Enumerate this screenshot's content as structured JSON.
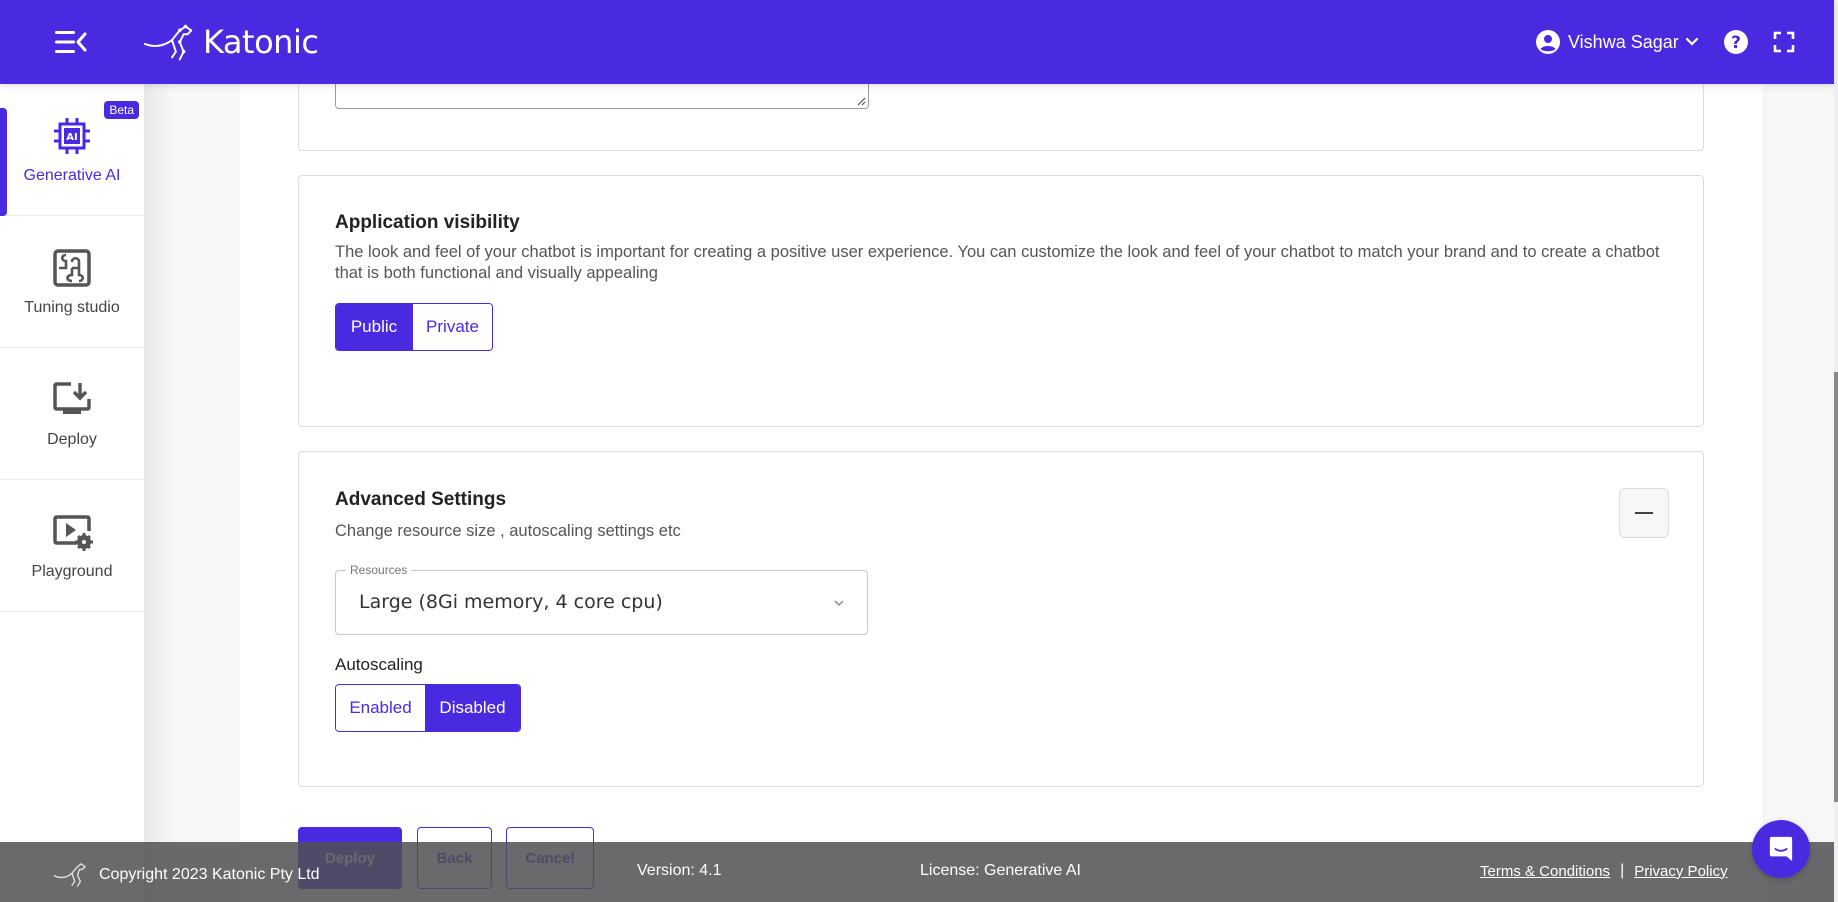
{
  "header": {
    "brand": "Katonic",
    "user_name": "Vishwa Sagar",
    "colors": {
      "primary": "#4a2ae0"
    }
  },
  "sidebar": {
    "items": [
      {
        "label": "Generative AI",
        "icon": "ai-chip-icon",
        "badge": "Beta",
        "active": true
      },
      {
        "label": "Tuning studio",
        "icon": "puzzle-icon",
        "active": false
      },
      {
        "label": "Deploy",
        "icon": "monitor-download-icon",
        "active": false
      },
      {
        "label": "Playground",
        "icon": "video-settings-icon",
        "active": false
      }
    ]
  },
  "visibility": {
    "title": "Application visibility",
    "description": "The look and feel of your chatbot is important for creating a positive user experience. You can customize the look and feel of your chatbot to match your brand and to create a chatbot that is both functional and visually appealing",
    "options": [
      "Public",
      "Private"
    ],
    "selected": "Public"
  },
  "advanced": {
    "title": "Advanced Settings",
    "description": "Change resource size , autoscaling settings etc",
    "resources_label": "Resources",
    "resources_value": "Large (8Gi memory, 4 core cpu)",
    "autoscaling_label": "Autoscaling",
    "autoscaling_options": [
      "Enabled",
      "Disabled"
    ],
    "autoscaling_selected": "Disabled"
  },
  "actions": {
    "deploy": "Deploy",
    "back": "Back",
    "cancel": "Cancel"
  },
  "footer": {
    "copyright": "Copyright 2023 Katonic Pty Ltd",
    "version": "Version: 4.1",
    "license": "License: Generative AI",
    "terms": "Terms & Conditions",
    "separator": "|",
    "privacy": "Privacy Policy"
  }
}
